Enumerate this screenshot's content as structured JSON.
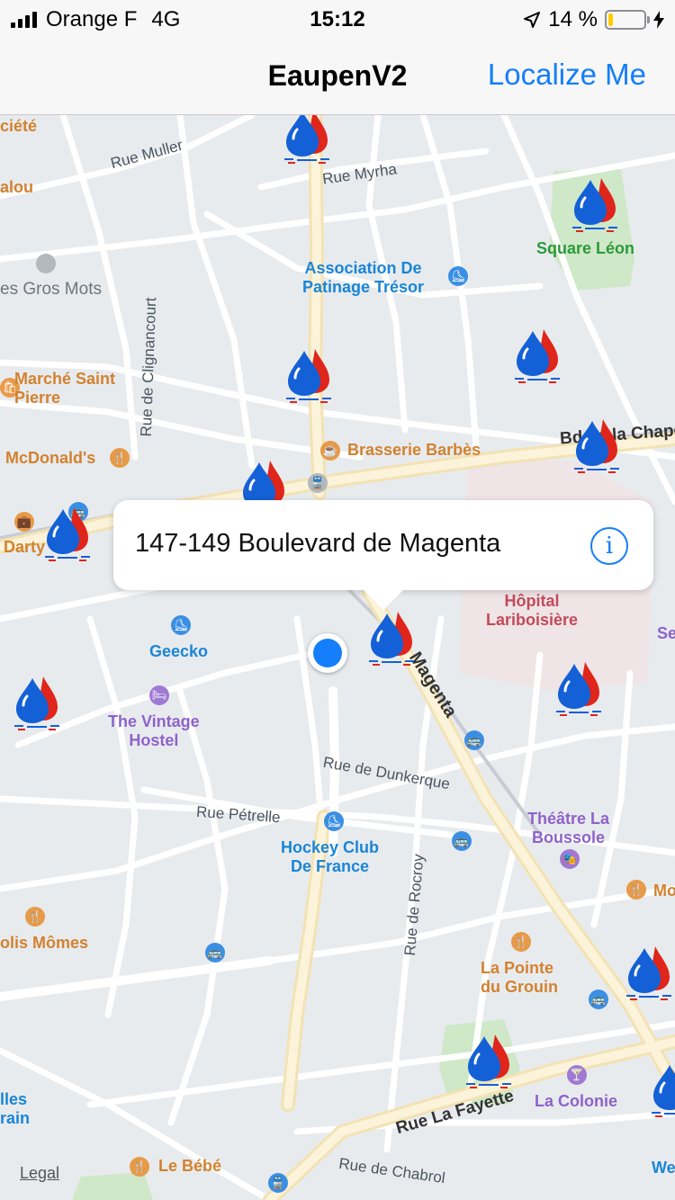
{
  "status": {
    "carrier": "Orange F",
    "network": "4G",
    "time": "15:12",
    "battery": "14 %",
    "battery_level": 0.14
  },
  "nav": {
    "title": "EaupenV2",
    "action": "Localize Me"
  },
  "callout": {
    "address": "147-149 Boulevard de Magenta",
    "info_symbol": "i"
  },
  "map": {
    "streets": {
      "rue_muller": "Rue Muller",
      "rue_myrha": "Rue Myrha",
      "rue_clignancourt": "Rue de Clignancourt",
      "bd_chapelle": "Bd de la Chapelle",
      "magenta": "Magenta",
      "rue_dunkerque": "Rue de Dunkerque",
      "rue_petrelle": "Rue Pétrelle",
      "rue_rocroy": "Rue de Rocroy",
      "rue_lafayette": "Rue La Fayette",
      "rue_chabrol": "Rue de Chabrol"
    },
    "places": {
      "societe": "ciété",
      "alou": "alou",
      "gros_mots": "es Gros Mots",
      "association": "Association De\nPatinage Trésor",
      "square_leon": "Square Léon",
      "marche_saint_pierre": "Marché Saint\nPierre",
      "mcdonalds": "McDonald's",
      "brasserie": "Brasserie Barbès",
      "darty": "Darty",
      "hopital": "Hôpital\nLariboisière",
      "se": "Se",
      "geecko": "Geecko",
      "vintage_hostel": "The Vintage\nHostel",
      "theatre": "Théâtre La\nBoussole",
      "hockey_club": "Hockey Club\nDe France",
      "mo": "Mo",
      "jolis_momes": "olis Mômes",
      "la_pointe": "La Pointe\ndu Grouin",
      "la_colonie": "La Colonie",
      "elles": "lles\nrain",
      "le_bebe": "Le Bébé",
      "we": "We"
    },
    "legal": "Legal"
  },
  "colors": {
    "accent": "#147efb",
    "marker_blue": "#1460d6",
    "marker_red": "#e0251b"
  }
}
